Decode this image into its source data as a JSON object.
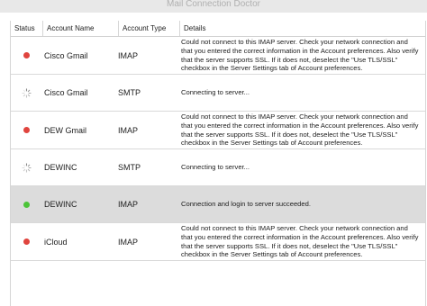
{
  "window": {
    "title": "Mail Connection Doctor"
  },
  "columns": {
    "status": "Status",
    "account_name": "Account Name",
    "account_type": "Account Type",
    "details": "Details"
  },
  "colors": {
    "error": "#e0443e",
    "ok": "#4cc438",
    "spinner": "#8a8a8a",
    "selected_row": "#dcdcdc"
  },
  "rows": [
    {
      "status": "error",
      "status_icon": "red-dot-icon",
      "name": "Cisco Gmail",
      "type": "IMAP",
      "details": "Could not connect to this IMAP server. Check your network connection and that you entered the correct information in the Account preferences. Also verify that the server supports SSL. If it does not, deselect the \"Use TLS/SSL\" checkbox in the Server Settings tab of Account preferences."
    },
    {
      "status": "connecting",
      "status_icon": "spinner-icon",
      "name": "Cisco Gmail",
      "type": "SMTP",
      "details": "Connecting to server..."
    },
    {
      "status": "error",
      "status_icon": "red-dot-icon",
      "name": "DEW Gmail",
      "type": "IMAP",
      "details": "Could not connect to this IMAP server. Check your network connection and that you entered the correct information in the Account preferences. Also verify that the server supports SSL. If it does not, deselect the \"Use TLS/SSL\" checkbox in the Server Settings tab of Account preferences."
    },
    {
      "status": "connecting",
      "status_icon": "spinner-icon",
      "name": "DEWINC",
      "type": "SMTP",
      "details": "Connecting to server..."
    },
    {
      "status": "ok",
      "status_icon": "green-dot-icon",
      "name": "DEWINC",
      "type": "IMAP",
      "details": "Connection and login to server succeeded."
    },
    {
      "status": "error",
      "status_icon": "red-dot-icon",
      "name": "iCloud",
      "type": "IMAP",
      "details": "Could not connect to this IMAP server. Check your network connection and that you entered the correct information in the Account preferences. Also verify that the server supports SSL. If it does not, deselect the \"Use TLS/SSL\" checkbox in the Server Settings tab of Account preferences."
    }
  ]
}
